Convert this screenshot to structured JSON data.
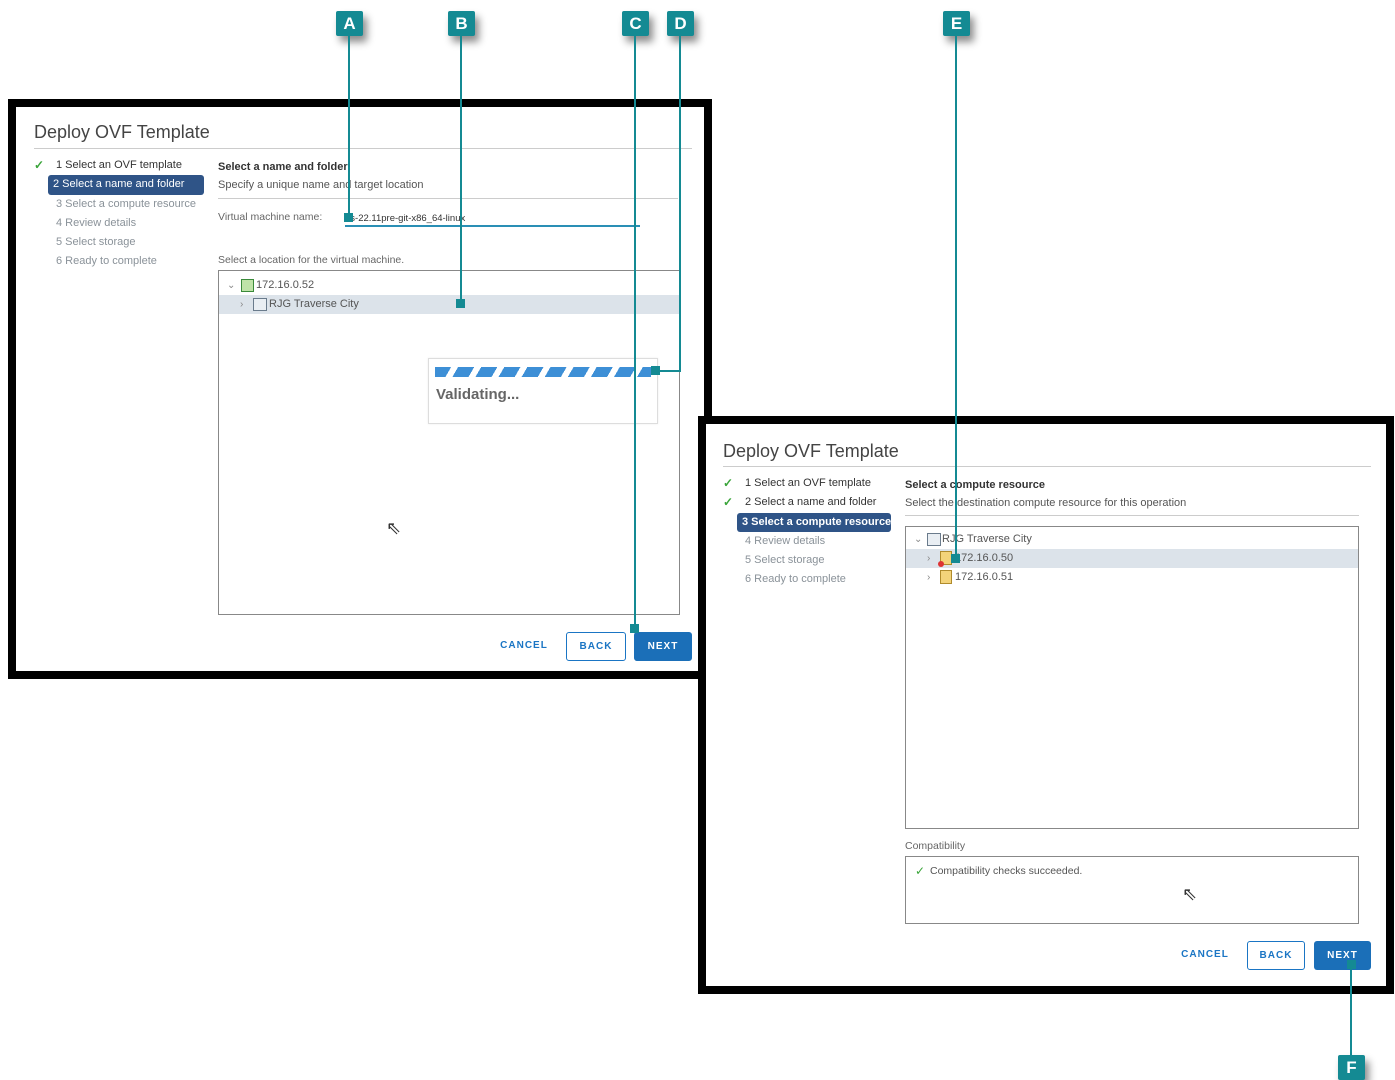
{
  "dialog1": {
    "title": "Deploy OVF Template",
    "steps": [
      {
        "label": "1 Select an OVF template",
        "state": "done"
      },
      {
        "label": "2 Select a name and folder",
        "state": "active"
      },
      {
        "label": "3 Select a compute resource",
        "state": "pending"
      },
      {
        "label": "4 Review details",
        "state": "pending"
      },
      {
        "label": "5 Select storage",
        "state": "pending"
      },
      {
        "label": "6 Ready to complete",
        "state": "pending"
      }
    ],
    "section_title": "Select a name and folder",
    "section_subtitle": "Specify a unique name and target location",
    "vm_name_label": "Virtual machine name:",
    "vm_name_value": "os-22.11pre-git-x86_64-linux",
    "location_label": "Select a location for the virtual machine.",
    "tree": [
      {
        "label": "172.16.0.52"
      },
      {
        "label": "RJG Traverse City"
      }
    ],
    "validating_text": "Validating...",
    "buttons": {
      "cancel": "CANCEL",
      "back": "BACK",
      "next": "NEXT"
    }
  },
  "dialog2": {
    "title": "Deploy OVF Template",
    "steps": [
      {
        "label": "1 Select an OVF template",
        "state": "done"
      },
      {
        "label": "2 Select a name and folder",
        "state": "done"
      },
      {
        "label": "3 Select a compute resource",
        "state": "active"
      },
      {
        "label": "4 Review details",
        "state": "pending"
      },
      {
        "label": "5 Select storage",
        "state": "pending"
      },
      {
        "label": "6 Ready to complete",
        "state": "pending"
      }
    ],
    "section_title": "Select a compute resource",
    "section_subtitle": "Select the destination compute resource for this operation",
    "tree": [
      {
        "label": "RJG Traverse City"
      },
      {
        "label": "172.16.0.50"
      },
      {
        "label": "172.16.0.51"
      }
    ],
    "compat_label": "Compatibility",
    "compat_text": "Compatibility checks succeeded.",
    "buttons": {
      "cancel": "CANCEL",
      "back": "BACK",
      "next": "NEXT"
    }
  },
  "callouts": {
    "a": "A",
    "b": "B",
    "c": "C",
    "d": "D",
    "e": "E",
    "f": "F"
  },
  "icons": {
    "check": "check-icon",
    "chevron": "chevron-right-icon",
    "expand": "chevron-down-icon",
    "cursor": "mouse-cursor-icon"
  },
  "colors": {
    "callout": "#148a93",
    "active_step": "#2f5487",
    "primary_button": "#1b6fb8",
    "progress": "#3d8fd6"
  }
}
